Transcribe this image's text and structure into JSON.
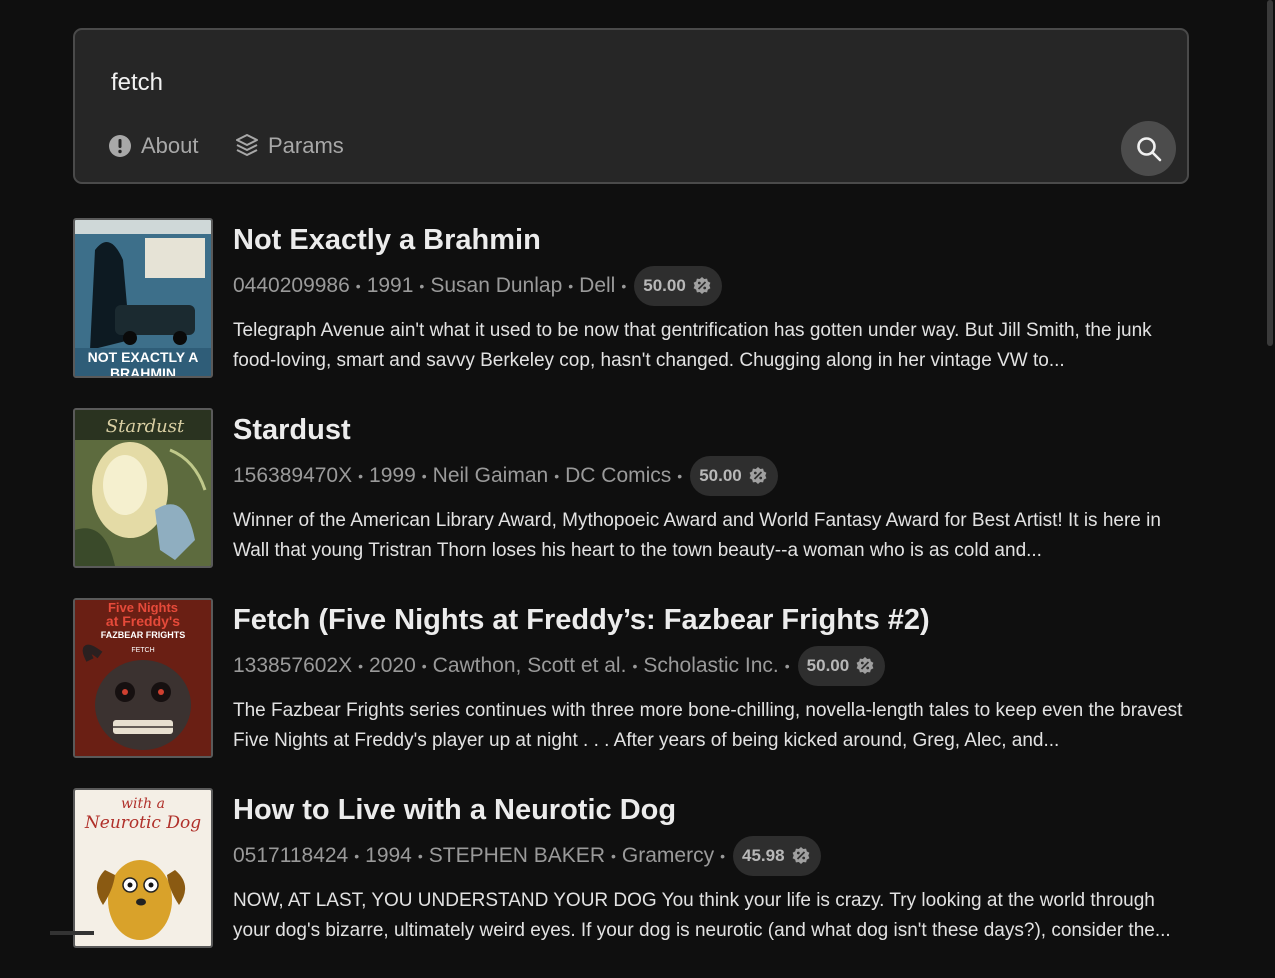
{
  "search": {
    "query": "fetch",
    "about_label": "About",
    "params_label": "Params",
    "submit_icon": "search-icon"
  },
  "results": [
    {
      "title": "Not Exactly a Brahmin",
      "isbn": "0440209986",
      "year": "1991",
      "author": "Susan Dunlap",
      "publisher": "Dell",
      "price": "50.00",
      "description": "Telegraph Avenue ain't what it used to be now that gentrification has gotten under way. But Jill Smith, the junk food-loving, smart and savvy Berkeley cop, hasn't changed. Chugging along in her vintage VW to...",
      "cover_text": "NOT EXACTLY A BRAHMIN"
    },
    {
      "title": "Stardust",
      "isbn": "156389470X",
      "year": "1999",
      "author": "Neil Gaiman",
      "publisher": "DC Comics",
      "price": "50.00",
      "description": "Winner of the American Library Award, Mythopoeic Award and World Fantasy Award for Best Artist! It is here in Wall that young Tristran Thorn loses his heart to the town beauty--a woman who is as cold and...",
      "cover_text": "STARDUST"
    },
    {
      "title": "Fetch (Five Nights at Freddy’s: Fazbear Frights #2)",
      "isbn": "133857602X",
      "year": "2020",
      "author": "Cawthon, Scott et al.",
      "publisher": "Scholastic Inc.",
      "price": "50.00",
      "description": "The Fazbear Frights series continues with three more bone-chilling, novella-length tales to keep even the bravest Five Nights at Freddy's player up at night . . . After years of being kicked around, Greg, Alec, and...",
      "cover_text": "Five Nights at Freddy's FAZBEAR FRIGHTS FETCH"
    },
    {
      "title": "How to Live with a Neurotic Dog",
      "isbn": "0517118424",
      "year": "1994",
      "author": "STEPHEN BAKER",
      "publisher": "Gramercy",
      "price": "45.98",
      "description": "NOW, AT LAST, YOU UNDERSTAND YOUR DOG You think your life is crazy. Try looking at the world through your dog's bizarre, ultimately weird eyes. If your dog is neurotic (and what dog isn't these days?), consider the...",
      "cover_text": "with a Neurotic Dog"
    }
  ],
  "colors": {
    "background": "#0f0f0f",
    "panel": "#262626",
    "badge": "#2e2e2e"
  }
}
